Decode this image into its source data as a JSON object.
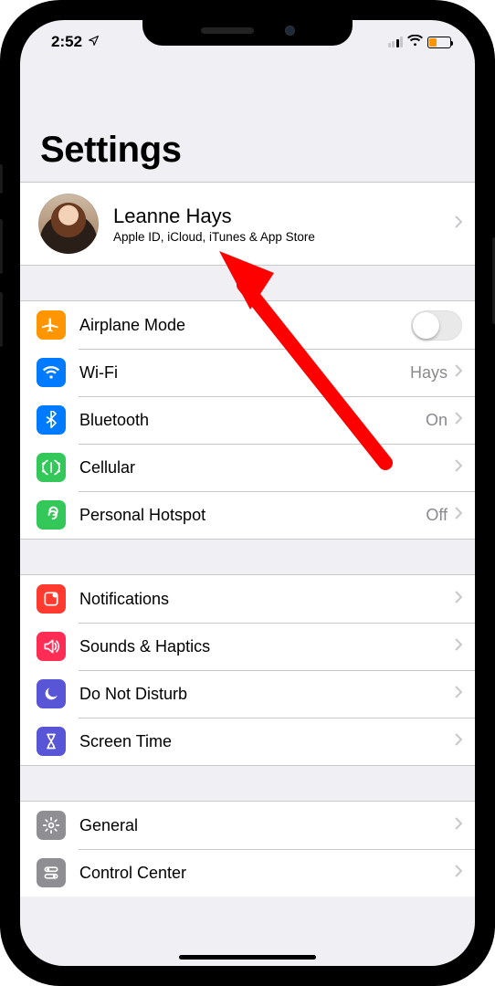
{
  "status": {
    "time": "2:52",
    "battery_percent": 35,
    "battery_color": "#ff9500"
  },
  "page": {
    "title": "Settings"
  },
  "profile": {
    "name": "Leanne Hays",
    "subtitle": "Apple ID, iCloud, iTunes & App Store"
  },
  "groups": [
    {
      "rows": [
        {
          "id": "airplane",
          "label": "Airplane Mode",
          "icon": "airplane",
          "color": "bg-orange",
          "type": "toggle",
          "value": false
        },
        {
          "id": "wifi",
          "label": "Wi-Fi",
          "icon": "wifi",
          "color": "bg-blue",
          "type": "nav",
          "detail": "Hays"
        },
        {
          "id": "bluetooth",
          "label": "Bluetooth",
          "icon": "bluetooth",
          "color": "bg-blue",
          "type": "nav",
          "detail": "On"
        },
        {
          "id": "cellular",
          "label": "Cellular",
          "icon": "cellular",
          "color": "bg-green",
          "type": "nav",
          "detail": ""
        },
        {
          "id": "hotspot",
          "label": "Personal Hotspot",
          "icon": "hotspot",
          "color": "bg-green",
          "type": "nav",
          "detail": "Off"
        }
      ]
    },
    {
      "rows": [
        {
          "id": "notifications",
          "label": "Notifications",
          "icon": "notifications",
          "color": "bg-red",
          "type": "nav",
          "detail": ""
        },
        {
          "id": "sounds",
          "label": "Sounds & Haptics",
          "icon": "sounds",
          "color": "bg-pink",
          "type": "nav",
          "detail": ""
        },
        {
          "id": "dnd",
          "label": "Do Not Disturb",
          "icon": "moon",
          "color": "bg-indigo",
          "type": "nav",
          "detail": ""
        },
        {
          "id": "screentime",
          "label": "Screen Time",
          "icon": "hourglass",
          "color": "bg-indigo",
          "type": "nav",
          "detail": ""
        }
      ]
    },
    {
      "rows": [
        {
          "id": "general",
          "label": "General",
          "icon": "gear",
          "color": "bg-gray",
          "type": "nav",
          "detail": ""
        },
        {
          "id": "controlcenter",
          "label": "Control Center",
          "icon": "switches",
          "color": "bg-gray",
          "type": "nav",
          "detail": ""
        }
      ]
    }
  ]
}
